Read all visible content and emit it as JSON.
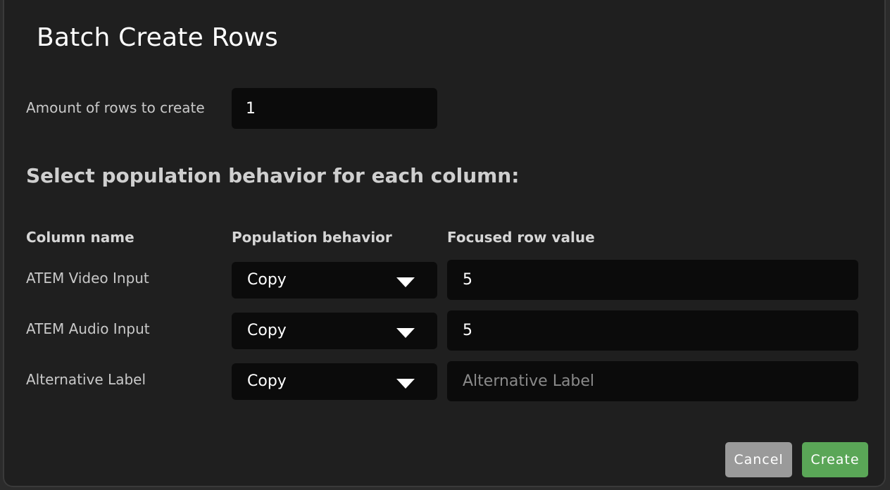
{
  "dialog": {
    "title": "Batch Create Rows",
    "amount_label": "Amount of rows to create",
    "amount_value": "1",
    "section_heading": "Select population behavior for each column:",
    "headers": {
      "column_name": "Column name",
      "population_behavior": "Population behavior",
      "focused_row_value": "Focused row value"
    },
    "rows": [
      {
        "name": "ATEM Video Input",
        "behavior": "Copy",
        "value": "5",
        "placeholder": ""
      },
      {
        "name": "ATEM Audio Input",
        "behavior": "Copy",
        "value": "5",
        "placeholder": ""
      },
      {
        "name": "Alternative Label",
        "behavior": "Copy",
        "value": "",
        "placeholder": "Alternative Label"
      }
    ],
    "buttons": {
      "cancel": "Cancel",
      "create": "Create"
    }
  },
  "colors": {
    "dialog_bg": "#1f1f1f",
    "input_bg": "#0b0b0b",
    "cancel_bg": "#9a9a9a",
    "create_bg": "#5aa657",
    "caret": "#3b8fe0"
  },
  "icons": {
    "dropdown": "chevron-down-icon"
  }
}
